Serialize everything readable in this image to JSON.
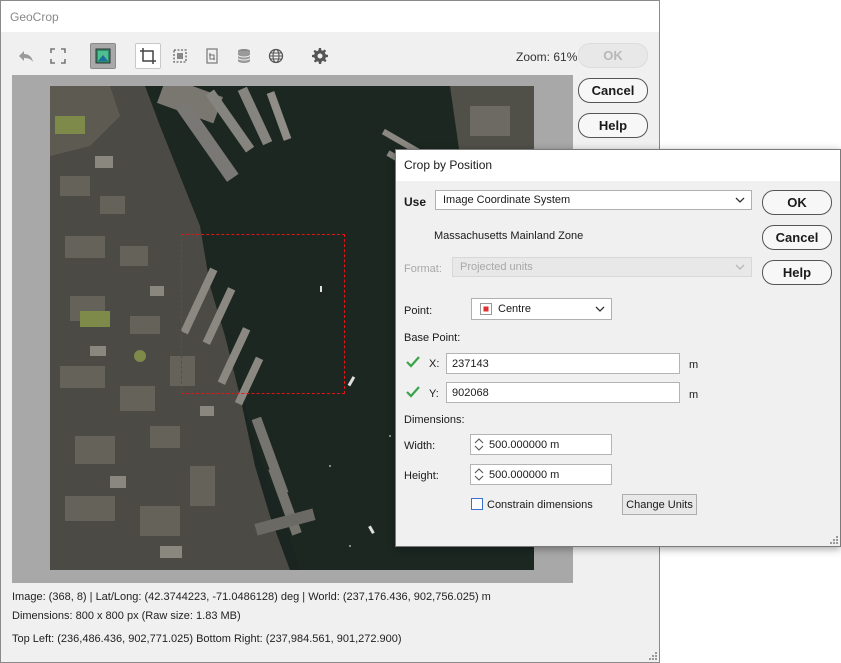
{
  "main": {
    "title": "GeoCrop",
    "zoom_label": "Zoom: 61%",
    "ok_label": "OK",
    "cancel_label": "Cancel",
    "help_label": "Help",
    "toolbar": {
      "icons": [
        "undo-icon",
        "fit-screen-icon",
        "image-view-icon",
        "crop-rect-icon",
        "crop-dashed-icon",
        "crop-position-icon",
        "layers-icon",
        "globe-icon",
        "gear-icon"
      ]
    },
    "status": {
      "line1": "Image: (368, 8) | Lat/Long: (42.3744223, -71.0486128) deg | World: (237,176.436, 902,756.025) m",
      "line2": "Dimensions: 800 x 800 px (Raw size: 1.83 MB)",
      "line3": "Top Left: (236,486.436, 902,771.025)   Bottom Right: (237,984.561, 901,272.900)"
    },
    "colors": {
      "crop_outline": "#e01515",
      "panel": "#a8a8a8"
    }
  },
  "dialog": {
    "title": "Crop by Position",
    "use_label": "Use",
    "use_value": "Image Coordinate System",
    "zone_text": "Massachusetts Mainland Zone",
    "format_label": "Format:",
    "format_value": "Projected units",
    "point_label": "Point:",
    "point_value": "Centre",
    "base_point_label": "Base Point:",
    "x_label": "X:",
    "x_value": "237143",
    "x_unit": "m",
    "y_label": "Y:",
    "y_value": "902068",
    "y_unit": "m",
    "dimensions_label": "Dimensions:",
    "width_label": "Width:",
    "width_value": "500.000000 m",
    "height_label": "Height:",
    "height_value": "500.000000 m",
    "constrain_label": "Constrain dimensions",
    "constrain_checked": false,
    "change_units_label": "Change Units",
    "ok_label": "OK",
    "cancel_label": "Cancel",
    "help_label": "Help",
    "colors": {
      "check": "#3aa34a",
      "point_marker": "#e03030"
    }
  }
}
